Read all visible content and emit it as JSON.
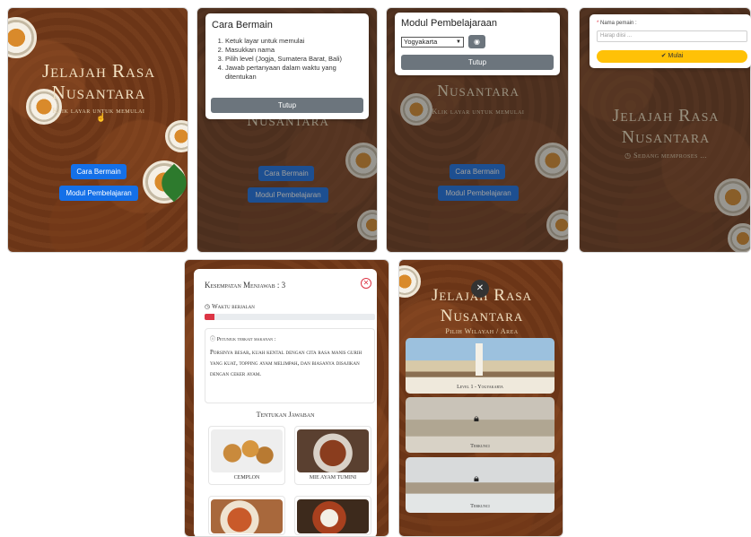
{
  "screen1": {
    "title_line1": "Jelajah Rasa",
    "title_line2": "Nusantara",
    "tagline": "Klik layar untuk memulai",
    "btn_how": "Cara Bermain",
    "btn_module": "Modul Pembelajaran"
  },
  "screen2": {
    "panel_title": "Cara Bermain",
    "steps": [
      "Ketuk layar untuk memulai",
      "Masukkan nama",
      "Pilih level (Jogja, Sumatera Barat, Bali)",
      "Jawab pertanyaan dalam waktu yang ditentukan"
    ],
    "close_label": "Tutup",
    "bg_title": "Nusantara",
    "bg_btn_how": "Cara Bermain",
    "bg_btn_module": "Modul Pembelajaran"
  },
  "screen3": {
    "panel_title": "Modul Pembelajaraan",
    "select_value": "Yogyakarta",
    "close_label": "Tutup",
    "bg_title": "Nusantara",
    "bg_tagline": "Klik layar untuk memulai",
    "bg_btn_how": "Cara Bermain",
    "bg_btn_module": "Modul Pembelajaran"
  },
  "screen4": {
    "field_label": "Nama pemain :",
    "field_placeholder": "Harap diisi ...",
    "start_label": "Mulai",
    "bg_title_line1": "Jelajah Rasa",
    "bg_title_line2": "Nusantara",
    "bg_loading": "Sedang memproses ..."
  },
  "screen5": {
    "chances": "Kesempatan Menjawab : 3",
    "timer_label": "Waktu berjalan",
    "timer_progress": 0.06,
    "hint_label": "Petunjuk terkait makanan :",
    "hint_text": "Porsinya besar, kuah kental dengan cita rasa manis gurih yang kuat, topping ayam melimpah, dan biasanya disajikan dengan ceker ayam.",
    "answer_heading": "Tentukan Jawaban",
    "options": [
      {
        "label": "CEMPLON"
      },
      {
        "label": "MIE AYAM TUMINI"
      },
      {
        "label": ""
      },
      {
        "label": ""
      }
    ]
  },
  "screen6": {
    "title_line1": "Jelajah Rasa",
    "title_line2": "Nusantara",
    "subtitle": "Pilih Wilayah / Area",
    "regions": [
      {
        "label": "Level 1 - Yogyakarta",
        "locked": false
      },
      {
        "label": "Terkunci",
        "locked": true
      },
      {
        "label": "Terkunci",
        "locked": true
      }
    ]
  },
  "colors": {
    "brown_bg": "#6b3517",
    "blue": "#1470e8",
    "gray": "#6c757d",
    "yellow": "#ffc107",
    "red": "#dc3545"
  }
}
